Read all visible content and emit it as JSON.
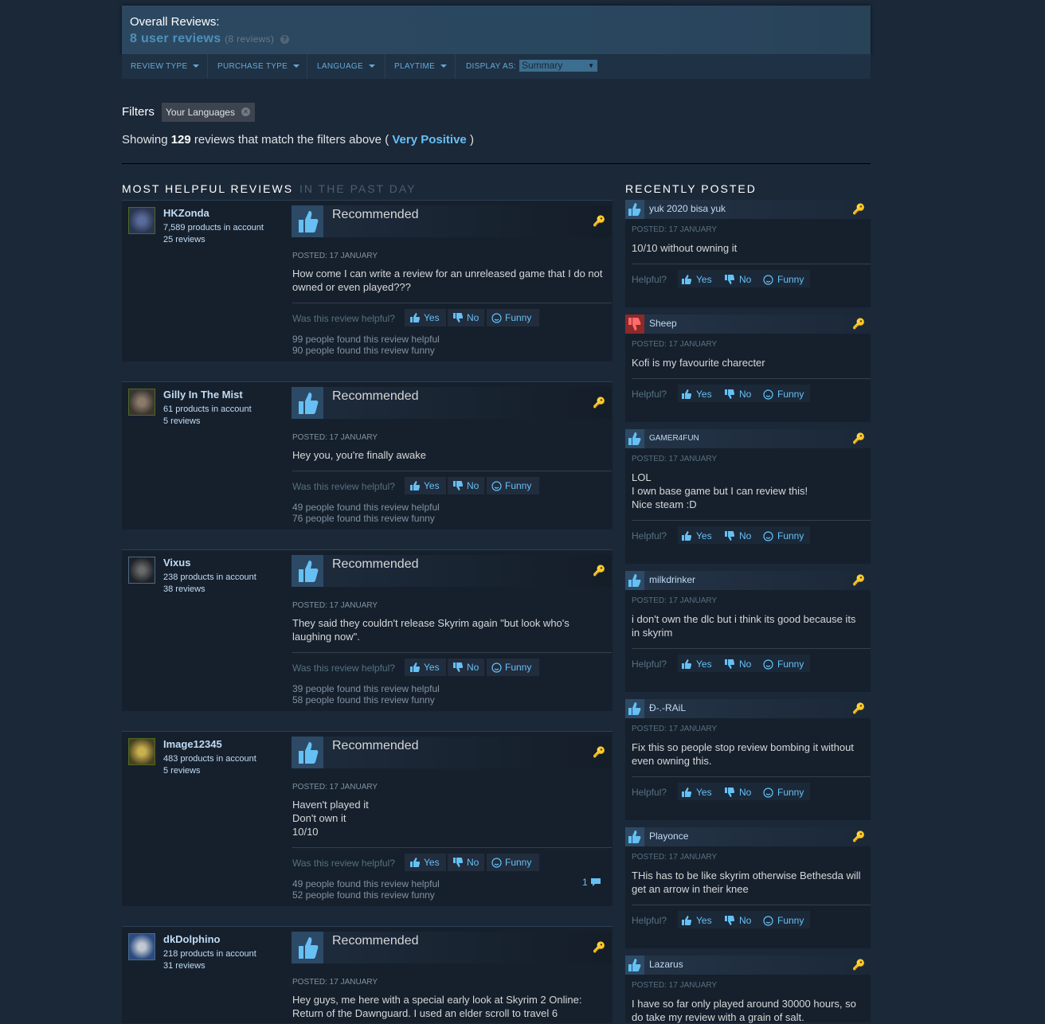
{
  "overall": {
    "title": "Overall Reviews:",
    "summary": "8 user reviews",
    "count": "(8 reviews)",
    "help": "?"
  },
  "filterbar": {
    "review_type": "REVIEW TYPE",
    "purchase_type": "PURCHASE TYPE",
    "language": "LANGUAGE",
    "playtime": "PLAYTIME",
    "display_as": "DISPLAY AS:",
    "display_value": "Summary"
  },
  "filters": {
    "label": "Filters",
    "chip": "Your Languages",
    "chip_close": "×"
  },
  "showing": {
    "prefix": "Showing",
    "count": "129",
    "middle": "reviews that match the filters above (",
    "rating": "Very Positive",
    "suffix": ")"
  },
  "sections": {
    "helpful_title": "MOST HELPFUL REVIEWS",
    "helpful_sub": "IN THE PAST DAY",
    "recent_title": "RECENTLY POSTED"
  },
  "common": {
    "recommended": "Recommended",
    "was_helpful": "Was this review helpful?",
    "helpful_short": "Helpful?",
    "yes": "Yes",
    "no": "No",
    "funny": "Funny",
    "key": "🔑"
  },
  "reviews": [
    {
      "user": "HKZonda",
      "products": "7,589 products in account",
      "reviews": "25 reviews",
      "posted": "POSTED: 17 JANUARY",
      "text": "How come I can write a review for an unreleased game that I do not owned or even played???",
      "helpful": "99 people found this review helpful",
      "funny": "90 people found this review funny"
    },
    {
      "user": "Gilly In The Mist",
      "products": "61 products in account",
      "reviews": "5 reviews",
      "posted": "POSTED: 17 JANUARY",
      "text": "Hey you, you're finally awake",
      "helpful": "49 people found this review helpful",
      "funny": "76 people found this review funny"
    },
    {
      "user": "Vixus",
      "products": "238 products in account",
      "reviews": "38 reviews",
      "posted": "POSTED: 17 JANUARY",
      "text": "They said they couldn't release Skyrim again \"but look who's laughing now\".",
      "helpful": "39 people found this review helpful",
      "funny": "58 people found this review funny"
    },
    {
      "user": "Image12345",
      "products": "483 products in account",
      "reviews": "5 reviews",
      "posted": "POSTED: 17 JANUARY",
      "text_lines": [
        "Haven't played it",
        "Don't own it",
        "10/10"
      ],
      "helpful": "49 people found this review helpful",
      "funny": "52 people found this review funny",
      "comments": "1"
    },
    {
      "user": "dkDolphino",
      "products": "218 products in account",
      "reviews": "31 reviews",
      "posted": "POSTED: 17 JANUARY",
      "text": "Hey guys, me here with a special early look at Skyrim 2 Online: Return of the Dawnguard. I used an elder scroll to travel 6"
    }
  ],
  "recent": [
    {
      "user": "yuk 2020 bisa yuk",
      "posted": "POSTED: 17 JANUARY",
      "text": "10/10 without owning it"
    },
    {
      "user": "Sheep",
      "posted": "POSTED: 17 JANUARY",
      "text": "Kofi is my favourite charecter"
    },
    {
      "user": "GAMER4FUN",
      "posted": "POSTED: 17 JANUARY",
      "text_lines": [
        "LOL",
        "I own base game but I can review this!",
        "Nice steam :D"
      ]
    },
    {
      "user": "milkdrinker",
      "posted": "POSTED: 17 JANUARY",
      "text": "i don't own the dlc but i think its good because its in skyrim"
    },
    {
      "user": "Đ-.-RAiL",
      "posted": "POSTED: 17 JANUARY",
      "text": "Fix this so people stop review bombing it without even owning this."
    },
    {
      "user": "Playonce",
      "posted": "POSTED: 17 JANUARY",
      "text": "THis has to be like skyrim otherwise Bethesda will get an arrow in their knee"
    },
    {
      "user": "Lazarus",
      "posted": "POSTED: 17 JANUARY",
      "text": "I have so far only played around 30000 hours, so do take my review with a grain of salt."
    }
  ],
  "colors": {
    "background": "#1b2838",
    "accent": "#66c0f4",
    "thumb_up_bg": "#2c4a66",
    "thumb_down_bg": "#8c2a2a"
  }
}
